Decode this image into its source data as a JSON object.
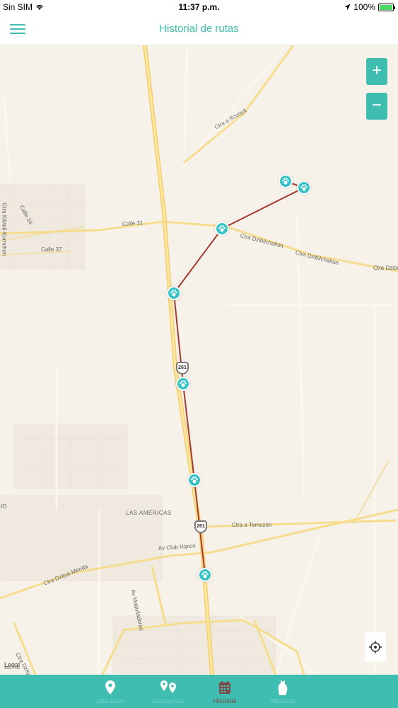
{
  "status_bar": {
    "carrier": "Sin SIM",
    "time": "11:37 p.m.",
    "battery": "100%"
  },
  "header": {
    "title": "Historial de rutas"
  },
  "map": {
    "labels": {
      "ctra_kikteil": "Ctra Kikteil-Komchen",
      "calle_34": "Calle 34",
      "calle_31": "Calle 31",
      "calle_37": "Calle 37",
      "ctra_xcunya": "Ctra a Xcunyá",
      "ctra_dzibilchaltun_1": "Ctra Dzibilchaltún",
      "ctra_dzibilchaltun_2": "Ctra Dzibilchaltún",
      "ctra_dzibilchaltun_3": "Ctra Dzibilchaltún",
      "las_americas": "LAS AMÉRICAS",
      "ctra_temozon": "Ctra a Temozón",
      "av_club_hipico": "Av Club Hípico",
      "ctra_dzitya_merida": "Ctra Dzityá-Mérida",
      "av_maquiladoras": "Av Maquiladoras",
      "ctra_dzitya": "Ctra Dzityá",
      "edge_label": "IO"
    },
    "shields": [
      "261",
      "261"
    ],
    "zoom_in": "+",
    "zoom_out": "−",
    "legal": "Legal",
    "route_color": "#a33a2e",
    "marker_color": "#36c2c6"
  },
  "tabs": [
    {
      "label": "Ubicación",
      "icon": "location-pin-icon",
      "active": false
    },
    {
      "label": "Geocercas",
      "icon": "geofence-icon",
      "active": false
    },
    {
      "label": "Historial",
      "icon": "calendar-icon",
      "active": true
    },
    {
      "label": "Mascota",
      "icon": "pet-icon",
      "active": false
    }
  ]
}
